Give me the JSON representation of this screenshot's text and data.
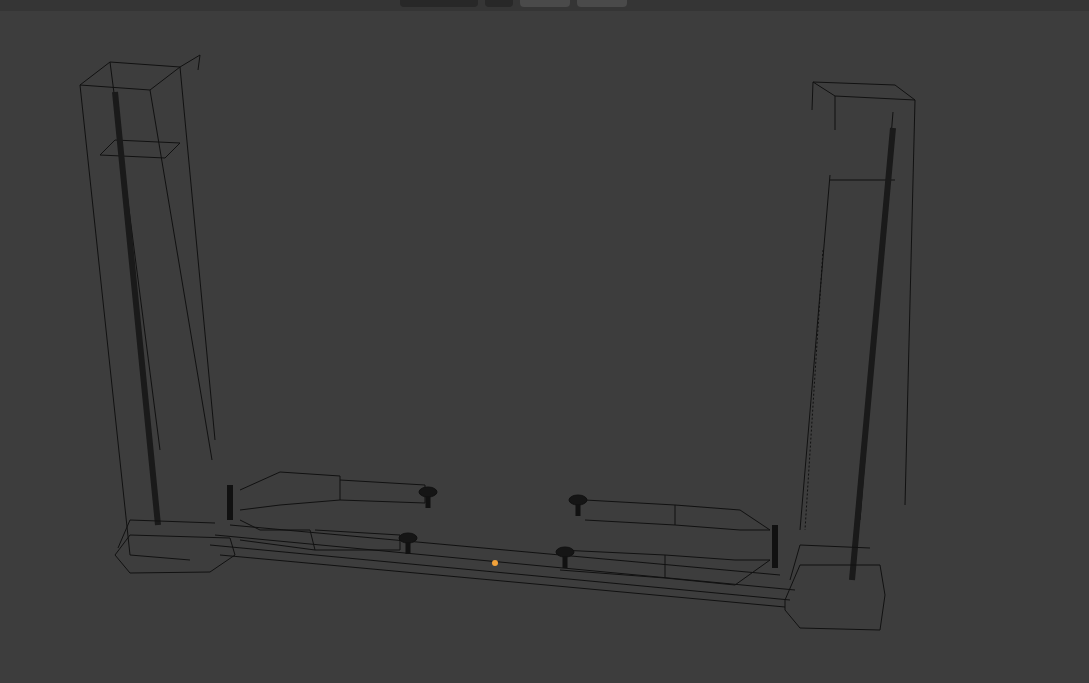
{
  "viewport": {
    "header": {
      "controls": [
        {
          "kind": "dropdown"
        },
        {
          "kind": "toggle"
        },
        {
          "kind": "pair"
        },
        {
          "kind": "pair"
        }
      ]
    },
    "model": {
      "kind": "wireframe"
    }
  }
}
